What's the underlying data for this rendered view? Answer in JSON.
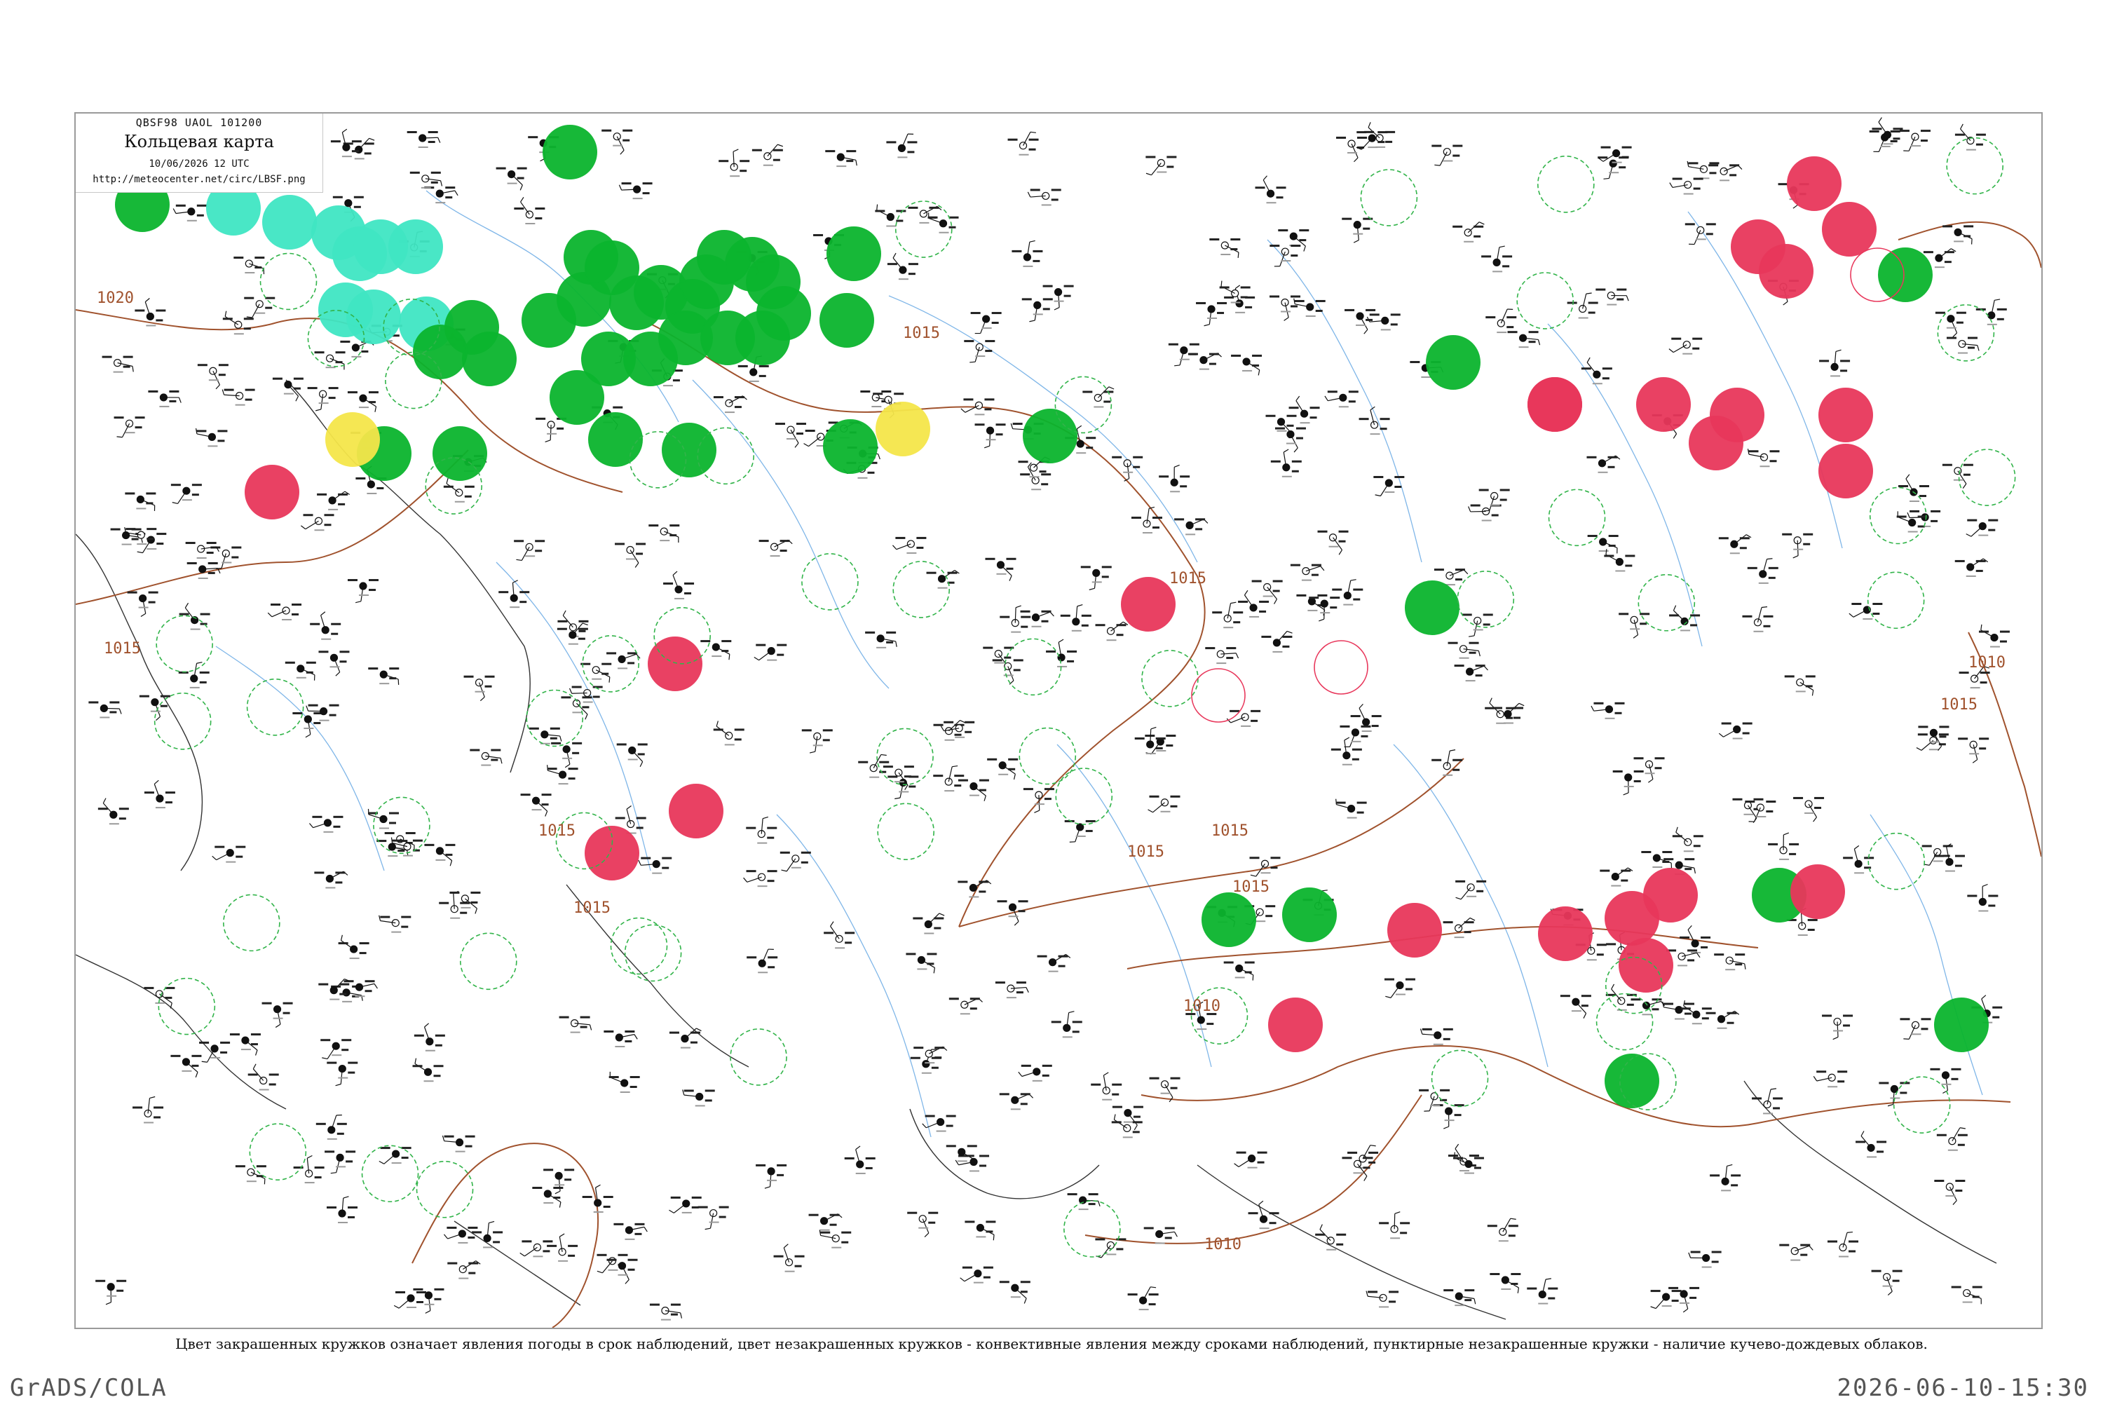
{
  "legend": {
    "bulletin_code": "QBSF98  UAOL  101200",
    "title": "Кольцевая карта",
    "datetime": "10/06/2026 12 UTC",
    "url": "http://meteocenter.net/circ/LBSF.png"
  },
  "caption": "Цвет закрашенных кружков означает явления погоды в срок наблюдений, цвет незакрашенных кружков - конвективные явления между сроками наблюдений, пунктирные незакрашенные кружки - наличие кучево-дождевых облаков.",
  "footer": {
    "software": "GrADS/COLA",
    "timestamp": "2026-06-10-15:30"
  },
  "isobars": {
    "color": "#a0522d",
    "labels": [
      "1020",
      "1015",
      "1015",
      "1015",
      "1015",
      "1015",
      "1010",
      "1010",
      "1015",
      "1010",
      "1015",
      "1015",
      "1015"
    ]
  },
  "colors": {
    "rain": "#0bb52e",
    "shower": "#40e6c3",
    "fog": "#f5e64a",
    "thunderstorm": "#e8375b",
    "river": "#7fb6e8",
    "coast": "#333333",
    "cb_ring": "#32b44a",
    "thunder_ring": "#e8375b"
  },
  "stations": {
    "rain_filled": 42,
    "shower_filled": 8,
    "fog_filled": 2,
    "thunderstorm_filled": 22,
    "cb_dashed_rings": 54,
    "thunder_rings": 4
  }
}
